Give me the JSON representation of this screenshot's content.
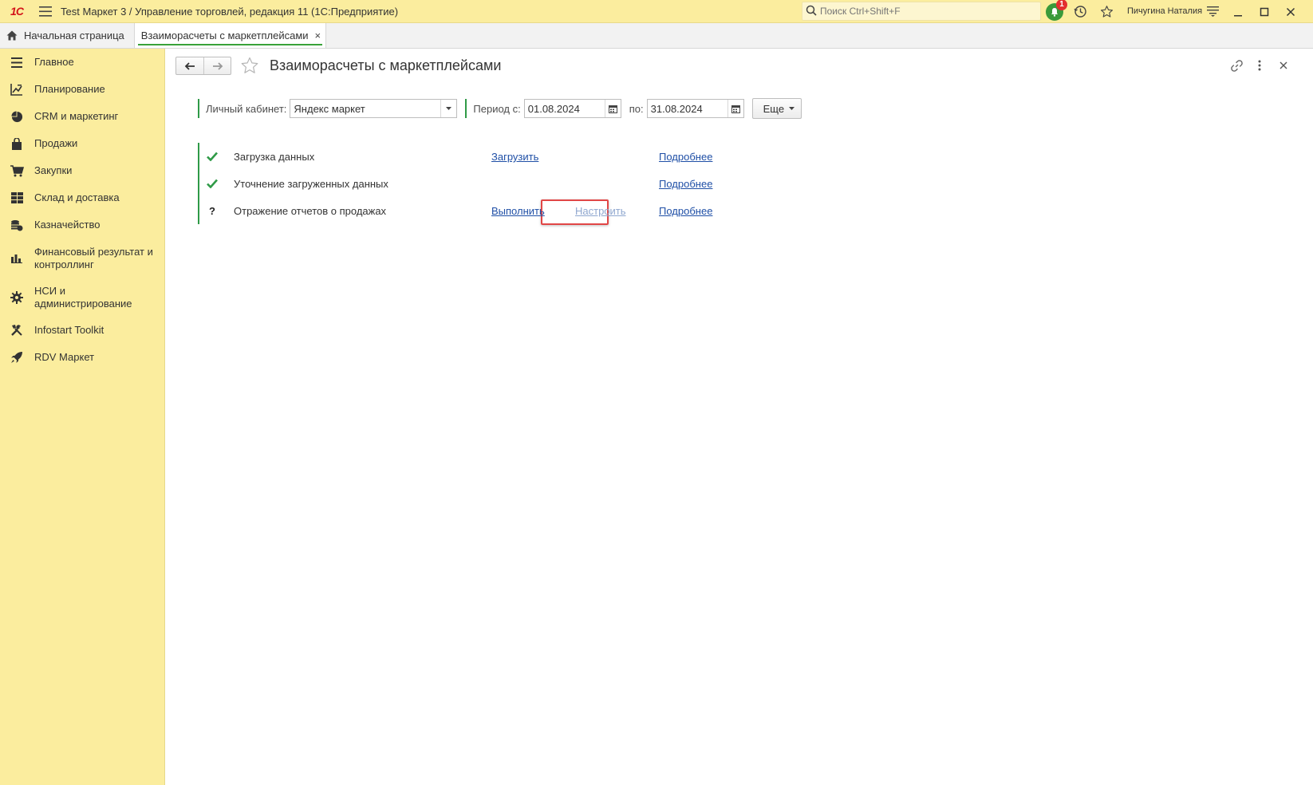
{
  "titlebar": {
    "logo": "1С",
    "app_title": "Test Маркет 3 / Управление торговлей, редакция 11  (1С:Предприятие)",
    "search_placeholder": "Поиск Ctrl+Shift+F",
    "notification_count": "1",
    "user_name": "Пичугина Наталия"
  },
  "tabs": {
    "home_label": "Начальная страница",
    "active_label": "Взаиморасчеты с маркетплейсами",
    "close_glyph": "×"
  },
  "sidebar": {
    "items": [
      {
        "label": "Главное",
        "icon": "menu-lines-icon"
      },
      {
        "label": "Планирование",
        "icon": "planning-chart-icon"
      },
      {
        "label": "CRM и маркетинг",
        "icon": "pie-chart-icon"
      },
      {
        "label": "Продажи",
        "icon": "shopping-bag-icon"
      },
      {
        "label": "Закупки",
        "icon": "cart-icon"
      },
      {
        "label": "Склад и доставка",
        "icon": "warehouse-grid-icon"
      },
      {
        "label": "Казначейство",
        "icon": "coins-icon"
      },
      {
        "label": "Финансовый результат и контроллинг",
        "icon": "bar-chart-icon"
      },
      {
        "label": "НСИ и администрирование",
        "icon": "gear-icon"
      },
      {
        "label": "Infostart Toolkit",
        "icon": "tools-icon"
      },
      {
        "label": "RDV Маркет",
        "icon": "rocket-icon"
      }
    ]
  },
  "page": {
    "title": "Взаиморасчеты с маркетплейсами"
  },
  "filters": {
    "account_label": "Личный кабинет:",
    "account_value": "Яндекс маркет",
    "period_from_label": "Период с:",
    "period_from_value": "01.08.2024",
    "period_to_label": "по:",
    "period_to_value": "31.08.2024",
    "more_label": "Еще"
  },
  "steps": [
    {
      "status": "done",
      "status_glyph": "✔",
      "label": "Загрузка данных",
      "action": "Загрузить",
      "details": "Подробнее"
    },
    {
      "status": "done",
      "status_glyph": "✔",
      "label": "Уточнение загруженных данных",
      "details": "Подробнее"
    },
    {
      "status": "pending",
      "status_glyph": "?",
      "label": "Отражение отчетов о продажах",
      "action": "Выполнить",
      "setup": "Настроить",
      "details": "Подробнее"
    }
  ],
  "colors": {
    "sidebar_bg": "#fbed9e",
    "accent_green": "#2f9a47",
    "link_blue": "#1f4fa6",
    "highlight_red": "#e14646"
  }
}
